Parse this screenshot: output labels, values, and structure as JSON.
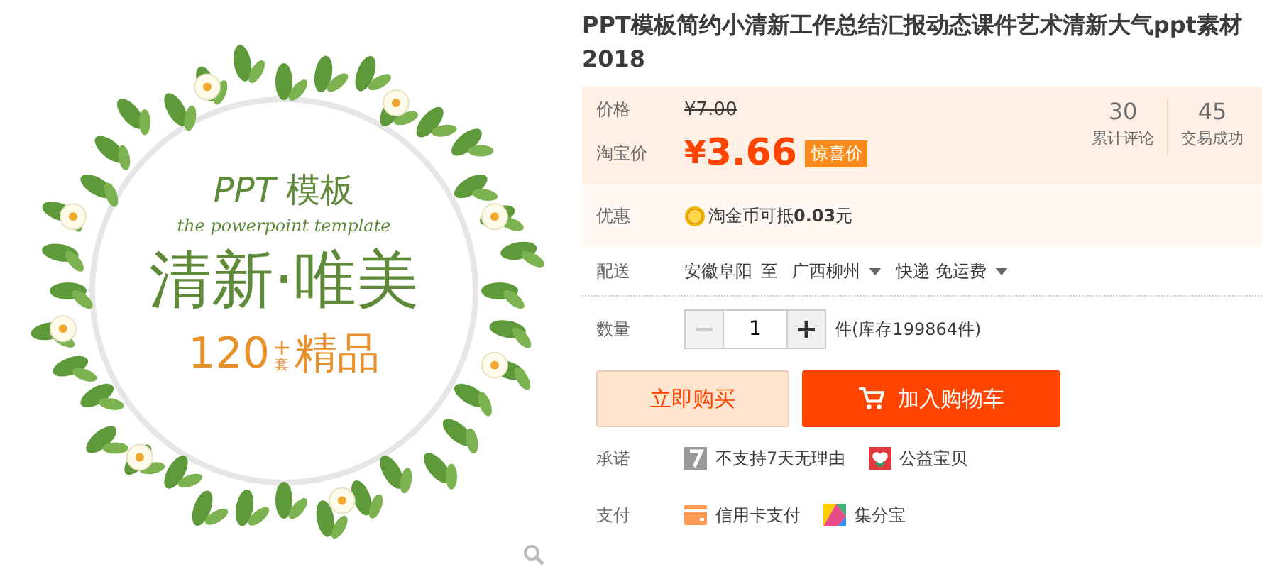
{
  "product_image": {
    "title_latin": "PPT",
    "title_cjk": "模板",
    "subtitle": "the powerpoint template",
    "headline": "清新·唯美",
    "count": "120",
    "count_plus": "+",
    "count_unit": "套",
    "tagline": "精品"
  },
  "title": "PPT模板简约小清新工作总结汇报动态课件艺术清新大气ppt素材2018",
  "price": {
    "label": "价格",
    "original": "¥7.00",
    "promo_label": "淘宝价",
    "currency": "¥",
    "amount": "3.66",
    "badge": "惊喜价"
  },
  "stats": [
    {
      "value": "30",
      "label": "累计评论"
    },
    {
      "value": "45",
      "label": "交易成功"
    }
  ],
  "discount": {
    "label": "优惠",
    "text": "淘金币可抵**0.03**元"
  },
  "delivery": {
    "label": "配送",
    "from": "安徽阜阳",
    "to_word": "至",
    "to": "广西柳州",
    "method": "快递 免运费"
  },
  "quantity": {
    "label": "数量",
    "value": "1",
    "decrease_disabled": true,
    "stock": "件(库存199864件)"
  },
  "buttons": [
    {
      "kind": "buy",
      "label": "立即购买"
    },
    {
      "kind": "cart",
      "label": "加入购物车"
    }
  ],
  "promises": {
    "label": "承诺",
    "items": [
      {
        "kind": "seven",
        "text": "不支持7天无理由"
      },
      {
        "kind": "charity",
        "text": "公益宝贝"
      }
    ]
  },
  "payment": {
    "label": "支付",
    "items": [
      {
        "kind": "card",
        "text": "信用卡支付"
      },
      {
        "kind": "points",
        "text": "集分宝"
      }
    ]
  }
}
